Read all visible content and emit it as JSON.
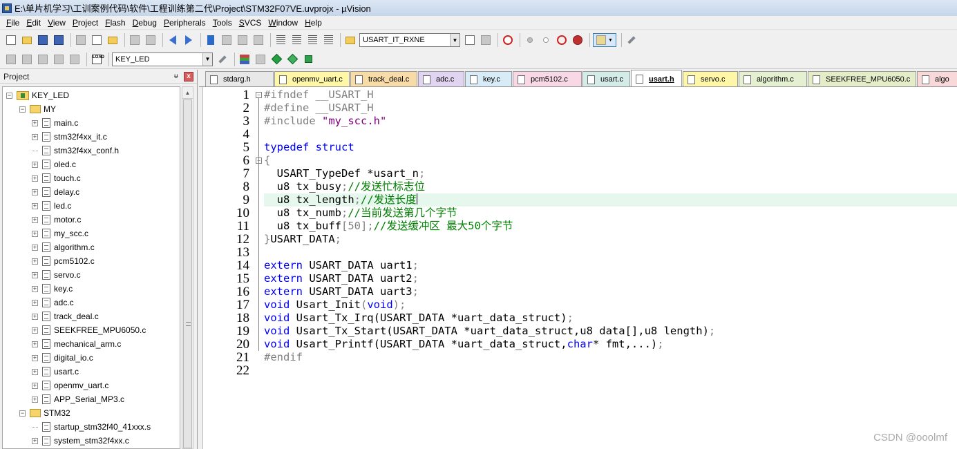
{
  "window": {
    "title": "E:\\单片机学习\\工训案例代码\\软件\\工程训练第二代\\Project\\STM32F07VE.uvprojx - µVision"
  },
  "menu": [
    {
      "u": "F",
      "rest": "ile"
    },
    {
      "u": "E",
      "rest": "dit"
    },
    {
      "u": "V",
      "rest": "iew"
    },
    {
      "u": "P",
      "rest": "roject"
    },
    {
      "u": "F",
      "rest": "lash"
    },
    {
      "u": "D",
      "rest": "ebug"
    },
    {
      "u": "P",
      "rest": "eripherals"
    },
    {
      "u": "T",
      "rest": "ools"
    },
    {
      "u": "S",
      "rest": "VCS"
    },
    {
      "u": "W",
      "rest": "indow"
    },
    {
      "u": "H",
      "rest": "elp"
    }
  ],
  "toolbar": {
    "find_combo_value": "USART_IT_RXNE",
    "target_combo_value": "KEY_LED",
    "load_label": "LOAD"
  },
  "project_panel": {
    "title": "Project",
    "pin": "ᵾ",
    "close": "x",
    "root": "KEY_LED",
    "groups": [
      {
        "name": "MY",
        "files": [
          {
            "name": "main.c",
            "expandable": true
          },
          {
            "name": "stm32f4xx_it.c",
            "expandable": true
          },
          {
            "name": "stm32f4xx_conf.h",
            "expandable": false
          },
          {
            "name": "oled.c",
            "expandable": true
          },
          {
            "name": "touch.c",
            "expandable": true
          },
          {
            "name": "delay.c",
            "expandable": true
          },
          {
            "name": "led.c",
            "expandable": true
          },
          {
            "name": "motor.c",
            "expandable": true
          },
          {
            "name": "my_scc.c",
            "expandable": true
          },
          {
            "name": "algorithm.c",
            "expandable": true
          },
          {
            "name": "pcm5102.c",
            "expandable": true
          },
          {
            "name": "servo.c",
            "expandable": true
          },
          {
            "name": "key.c",
            "expandable": true
          },
          {
            "name": "adc.c",
            "expandable": true
          },
          {
            "name": "track_deal.c",
            "expandable": true
          },
          {
            "name": "SEEKFREE_MPU6050.c",
            "expandable": true
          },
          {
            "name": "mechanical_arm.c",
            "expandable": true
          },
          {
            "name": "digital_io.c",
            "expandable": true
          },
          {
            "name": "usart.c",
            "expandable": true
          },
          {
            "name": "openmv_uart.c",
            "expandable": true
          },
          {
            "name": "APP_Serial_MP3.c",
            "expandable": true
          }
        ]
      },
      {
        "name": "STM32",
        "files": [
          {
            "name": "startup_stm32f40_41xxx.s",
            "expandable": false
          },
          {
            "name": "system_stm32f4xx.c",
            "expandable": true
          }
        ]
      }
    ]
  },
  "tabs": [
    {
      "label": "stdarg.h",
      "color": "#e8e8e8",
      "active": false
    },
    {
      "label": "openmv_uart.c",
      "color": "#fff7a8",
      "active": false
    },
    {
      "label": "track_deal.c",
      "color": "#f8dca8",
      "active": false
    },
    {
      "label": "adc.c",
      "color": "#e0d4f0",
      "active": false
    },
    {
      "label": "key.c",
      "color": "#d8ecf8",
      "active": false
    },
    {
      "label": "pcm5102.c",
      "color": "#f8d8e4",
      "active": false
    },
    {
      "label": "usart.c",
      "color": "#d4ece8",
      "active": false
    },
    {
      "label": "usart.h",
      "color": "#ffffff",
      "active": true
    },
    {
      "label": "servo.c",
      "color": "#fff7a8",
      "active": false
    },
    {
      "label": "algorithm.c",
      "color": "#e4f0d0",
      "active": false
    },
    {
      "label": "SEEKFREE_MPU6050.c",
      "color": "#e4ecc8",
      "active": false
    },
    {
      "label": "algo",
      "color": "#f8d8d8",
      "active": false
    }
  ],
  "editor": {
    "current_line": 9,
    "lines": [
      {
        "n": "1",
        "fold": "minus",
        "parts": [
          [
            "pp",
            "#ifndef __USART_H"
          ]
        ]
      },
      {
        "n": "2",
        "parts": [
          [
            "pp",
            "#define __USART_H"
          ]
        ]
      },
      {
        "n": "3",
        "parts": [
          [
            "pp",
            "#include "
          ],
          [
            "str",
            "\"my_scc.h\""
          ]
        ]
      },
      {
        "n": "4",
        "parts": []
      },
      {
        "n": "5",
        "parts": [
          [
            "kw",
            "typedef"
          ],
          [
            "",
            " "
          ],
          [
            "kw",
            "struct"
          ]
        ]
      },
      {
        "n": "6",
        "fold": "minus",
        "parts": [
          [
            "op",
            "{"
          ]
        ]
      },
      {
        "n": "7",
        "parts": [
          [
            "",
            "  USART_TypeDef *usart_n"
          ],
          [
            "op",
            ";"
          ]
        ]
      },
      {
        "n": "8",
        "parts": [
          [
            "",
            "  u8 tx_busy"
          ],
          [
            "op",
            ";"
          ],
          [
            "cm",
            "//发送忙标志位"
          ]
        ]
      },
      {
        "n": "9",
        "parts": [
          [
            "",
            "  u8 tx_length"
          ],
          [
            "op",
            ";"
          ],
          [
            "cm",
            "//发送长度"
          ],
          [
            "caret",
            ""
          ]
        ]
      },
      {
        "n": "10",
        "parts": [
          [
            "",
            "  u8 tx_numb"
          ],
          [
            "op",
            ";"
          ],
          [
            "cm",
            "//当前发送第几个字节"
          ]
        ]
      },
      {
        "n": "11",
        "parts": [
          [
            "",
            "  u8 tx_buff"
          ],
          [
            "op",
            "["
          ],
          [
            "num",
            "50"
          ],
          [
            "op",
            "];"
          ],
          [
            "cm",
            "//发送缓冲区 最大50个字节"
          ]
        ]
      },
      {
        "n": "12",
        "parts": [
          [
            "op",
            "}"
          ],
          [
            "",
            "USART_DATA"
          ],
          [
            "op",
            ";"
          ]
        ]
      },
      {
        "n": "13",
        "parts": []
      },
      {
        "n": "14",
        "parts": [
          [
            "kw",
            "extern"
          ],
          [
            "",
            " USART_DATA uart1"
          ],
          [
            "op",
            ";"
          ]
        ]
      },
      {
        "n": "15",
        "parts": [
          [
            "kw",
            "extern"
          ],
          [
            "",
            " USART_DATA uart2"
          ],
          [
            "op",
            ";"
          ]
        ]
      },
      {
        "n": "16",
        "parts": [
          [
            "kw",
            "extern"
          ],
          [
            "",
            " USART_DATA uart3"
          ],
          [
            "op",
            ";"
          ]
        ]
      },
      {
        "n": "17",
        "parts": [
          [
            "kw",
            "void"
          ],
          [
            "",
            " Usart_Init"
          ],
          [
            "op",
            "("
          ],
          [
            "kw",
            "void"
          ],
          [
            "op",
            ");"
          ]
        ]
      },
      {
        "n": "18",
        "parts": [
          [
            "kw",
            "void"
          ],
          [
            "",
            " Usart_Tx_Irq(USART_DATA *uart_data_struct)"
          ],
          [
            "op",
            ";"
          ]
        ]
      },
      {
        "n": "19",
        "parts": [
          [
            "kw",
            "void"
          ],
          [
            "",
            " Usart_Tx_Start(USART_DATA *uart_data_struct,u8 data[],u8 length)"
          ],
          [
            "op",
            ";"
          ]
        ]
      },
      {
        "n": "20",
        "parts": [
          [
            "kw",
            "void"
          ],
          [
            "",
            " Usart_Printf(USART_DATA *uart_data_struct,"
          ],
          [
            "kw",
            "char"
          ],
          [
            "",
            "* fmt,...)"
          ],
          [
            "op",
            ";"
          ]
        ]
      },
      {
        "n": "21",
        "parts": [
          [
            "pp",
            "#endif"
          ]
        ]
      },
      {
        "n": "22",
        "parts": []
      }
    ]
  },
  "watermark": "CSDN @ooolmf"
}
